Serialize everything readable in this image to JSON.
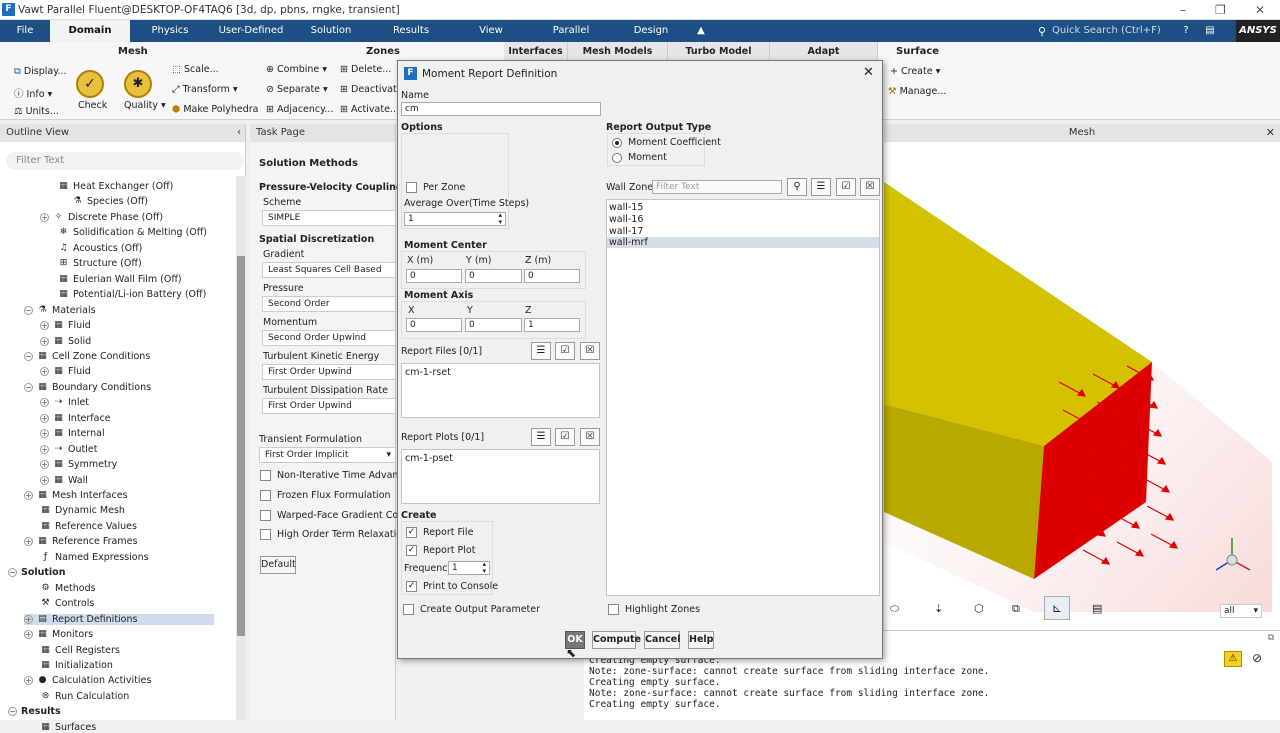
{
  "window": {
    "title": "Vawt Parallel Fluent@DESKTOP-OF4TAQ6  [3d, dp, pbns, rngke, transient]"
  },
  "menubar": {
    "items": [
      "File",
      "Domain",
      "Physics",
      "User-Defined",
      "Solution",
      "Results",
      "View",
      "Parallel",
      "Design"
    ],
    "search_placeholder": "Quick Search (Ctrl+F)",
    "brand": "ANSYS"
  },
  "ribbon": {
    "mesh": {
      "title": "Mesh",
      "display": "Display...",
      "info": "Info",
      "units": "Units...",
      "check": "Check",
      "quality": "Quality",
      "scale": "Scale...",
      "transform": "Transform",
      "make_polyhedra": "Make Polyhedra"
    },
    "zones": {
      "title": "Zones",
      "combine": "Combine",
      "separate": "Separate",
      "adjacency": "Adjacency...",
      "delete": "Delete...",
      "deactivate": "Deactivate...",
      "activate": "Activate..."
    },
    "interfaces": "Interfaces",
    "mesh_models": "Mesh Models",
    "turbo_model": "Turbo Model",
    "adapt": "Adapt",
    "surface": {
      "title": "Surface",
      "create": "Create",
      "manage": "Manage..."
    }
  },
  "outline": {
    "title": "Outline View",
    "filter_placeholder": "Filter Text",
    "items": [
      "Heat Exchanger (Off)",
      "Species (Off)",
      "Discrete Phase (Off)",
      "Solidification & Melting (Off)",
      "Acoustics (Off)",
      "Structure (Off)",
      "Eulerian Wall Film (Off)",
      "Potential/Li-ion Battery (Off)",
      "Materials",
      "Fluid",
      "Solid",
      "Cell Zone Conditions",
      "Fluid",
      "Boundary Conditions",
      "Inlet",
      "Interface",
      "Internal",
      "Outlet",
      "Symmetry",
      "Wall",
      "Mesh Interfaces",
      "Dynamic Mesh",
      "Reference Values",
      "Reference Frames",
      "Named Expressions",
      "Solution",
      "Methods",
      "Controls",
      "Report Definitions",
      "Monitors",
      "Cell Registers",
      "Initialization",
      "Calculation Activities",
      "Run Calculation",
      "Results",
      "Surfaces"
    ]
  },
  "task": {
    "title": "Task Page",
    "heading": "Solution Methods",
    "pv_coupling": "Pressure-Velocity Coupling",
    "scheme_label": "Scheme",
    "scheme": "SIMPLE",
    "spatial": "Spatial Discretization",
    "gradient_label": "Gradient",
    "gradient": "Least Squares Cell Based",
    "pressure_label": "Pressure",
    "pressure": "Second Order",
    "momentum_label": "Momentum",
    "momentum": "Second Order Upwind",
    "tke_label": "Turbulent Kinetic Energy",
    "tke": "First Order Upwind",
    "tdr_label": "Turbulent Dissipation Rate",
    "tdr": "First Order Upwind",
    "transient_label": "Transient Formulation",
    "transient": "First Order Implicit",
    "opt1": "Non-Iterative Time Advancemen",
    "opt2": "Frozen Flux Formulation",
    "opt3": "Warped-Face Gradient Correctio",
    "opt4": "High Order Term Relaxation",
    "default_btn": "Default"
  },
  "mesh_view": {
    "title": "Mesh",
    "view_select": "all"
  },
  "console": {
    "lines": [
      "Creating empty surface.",
      "Note: zone-surface: cannot create surface from sliding interface zone.",
      "Creating empty surface.",
      "Note: zone-surface: cannot create surface from sliding interface zone.",
      "Creating empty surface."
    ]
  },
  "dialog": {
    "title": "Moment Report Definition",
    "name_label": "Name",
    "name_value": "cm",
    "options_label": "Options",
    "per_zone": "Per Zone",
    "avg_label": "Average Over(Time Steps)",
    "avg_value": "1",
    "center_label": "Moment Center",
    "cx_label": "X (m)",
    "cy_label": "Y (m)",
    "cz_label": "Z (m)",
    "cx": "0",
    "cy": "0",
    "cz": "0",
    "axis_label": "Moment Axis",
    "ax_label": "X",
    "ay_label": "Y",
    "az_label": "Z",
    "ax": "0",
    "ay": "0",
    "az": "1",
    "report_files_label": "Report Files  [0/1]",
    "report_file_item": "cm-1-rset",
    "report_plots_label": "Report Plots  [0/1]",
    "report_plot_item": "cm-1-pset",
    "create_label": "Create",
    "create_file": "Report File",
    "create_plot": "Report Plot",
    "freq_label": "Frequency",
    "freq_value": "1",
    "print_console": "Print to Console",
    "create_output_param": "Create Output Parameter",
    "output_type_label": "Report Output Type",
    "moment_coef": "Moment Coefficient",
    "moment": "Moment",
    "wall_zones_label": "Wall Zones",
    "wall_filter_placeholder": "Filter Text",
    "walls": [
      "wall-15",
      "wall-16",
      "wall-17",
      "wall-mrf"
    ],
    "highlight_zones": "Highlight Zones",
    "ok": "OK",
    "compute": "Compute",
    "cancel": "Cancel",
    "help": "Help"
  }
}
